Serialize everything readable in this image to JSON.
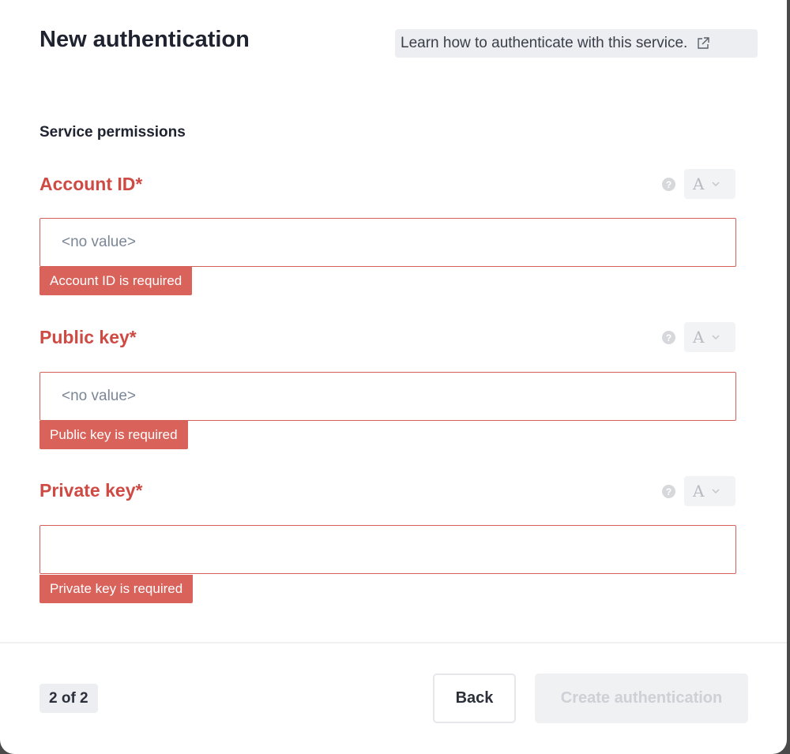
{
  "modal": {
    "title": "New authentication",
    "learn_link": {
      "label": "Learn how to authenticate with this service.",
      "icon": "external-link-icon"
    },
    "section_label": "Service permissions"
  },
  "fields": [
    {
      "label": "Account ID*",
      "value": "<no value>",
      "error": "Account ID is required",
      "type_selector": "A"
    },
    {
      "label": "Public key*",
      "value": "<no value>",
      "error": "Public key is required",
      "type_selector": "A"
    },
    {
      "label": "Private key*",
      "value": "",
      "error": "Private key is required",
      "type_selector": "A"
    }
  ],
  "footer": {
    "step": "2 of 2",
    "back_label": "Back",
    "create_label": "Create authentication"
  },
  "colors": {
    "error": "#cf4a43",
    "error_badge": "#d9625b",
    "text": "#1f2330"
  }
}
